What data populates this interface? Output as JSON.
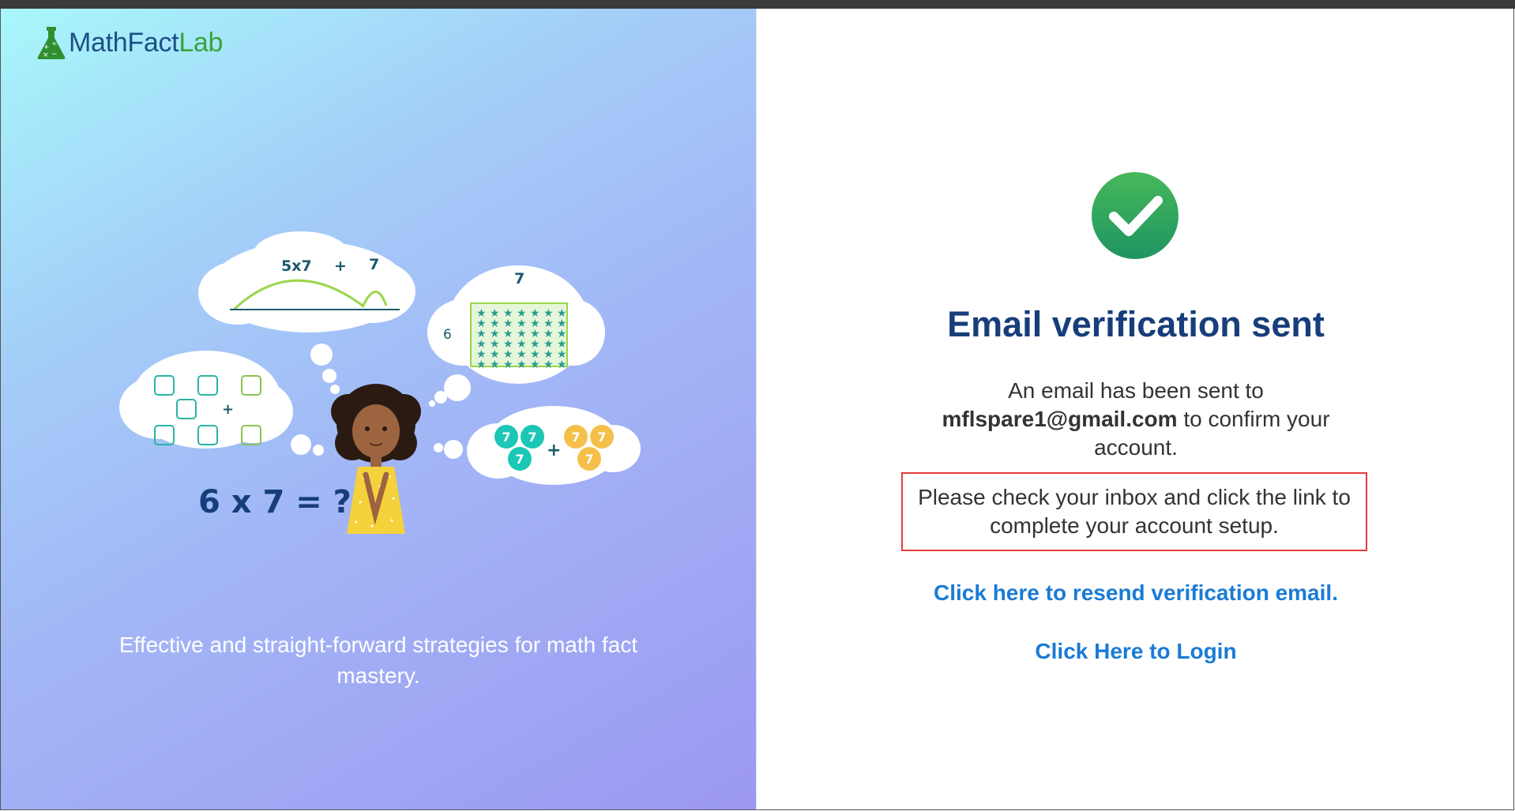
{
  "brand": {
    "name_part1": "MathFact",
    "name_part2": "Lab",
    "colors": {
      "blue": "#1d4f86",
      "green": "#3aa33a"
    }
  },
  "left_panel": {
    "illustration": {
      "cloud_numberline": {
        "label_a": "5x7",
        "label_plus": "+",
        "label_b": "7"
      },
      "cloud_array": {
        "top_label": "7",
        "side_label": "6"
      },
      "cloud_dice": {
        "plus": "+"
      },
      "cloud_circles": {
        "values": [
          "7",
          "7",
          "7",
          "7",
          "7",
          "7"
        ],
        "plus": "+"
      },
      "equation": "6 x 7 = ?"
    },
    "tagline": "Effective and straight-forward strategies for math fact mastery."
  },
  "right_panel": {
    "status_icon": "check-circle-icon",
    "title": "Email verification sent",
    "message_prefix": "An email has been sent to",
    "email": "mflspare1@gmail.com",
    "message_suffix": "to confirm your account.",
    "notice": "Please check your inbox and click the link to complete your account setup.",
    "resend_link": "Click here to resend verification email.",
    "login_link": "Click Here to Login",
    "colors": {
      "title": "#173e7a",
      "link": "#1a7bd6",
      "notice_border": "#e53b3b",
      "success": "#2aa05a"
    }
  }
}
